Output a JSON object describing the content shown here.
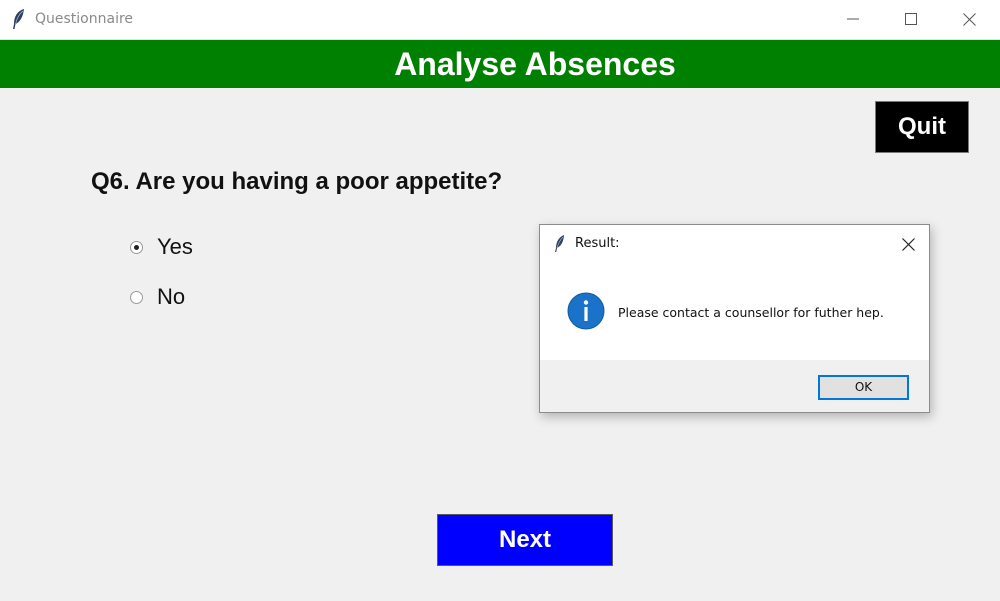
{
  "window": {
    "title": "Questionnaire"
  },
  "header": {
    "title": "Analyse Absences",
    "color": "#008000"
  },
  "quit_button": {
    "label": "Quit"
  },
  "question": {
    "text": "Q6. Are you having a poor appetite?",
    "options": [
      {
        "label": "Yes",
        "selected": true
      },
      {
        "label": "No",
        "selected": false
      }
    ]
  },
  "next_button": {
    "label": "Next",
    "color": "#0000ff"
  },
  "dialog": {
    "title": "Result:",
    "icon": "info-icon",
    "message": "Please contact a counsellor for futher hep.",
    "ok_label": "OK"
  }
}
